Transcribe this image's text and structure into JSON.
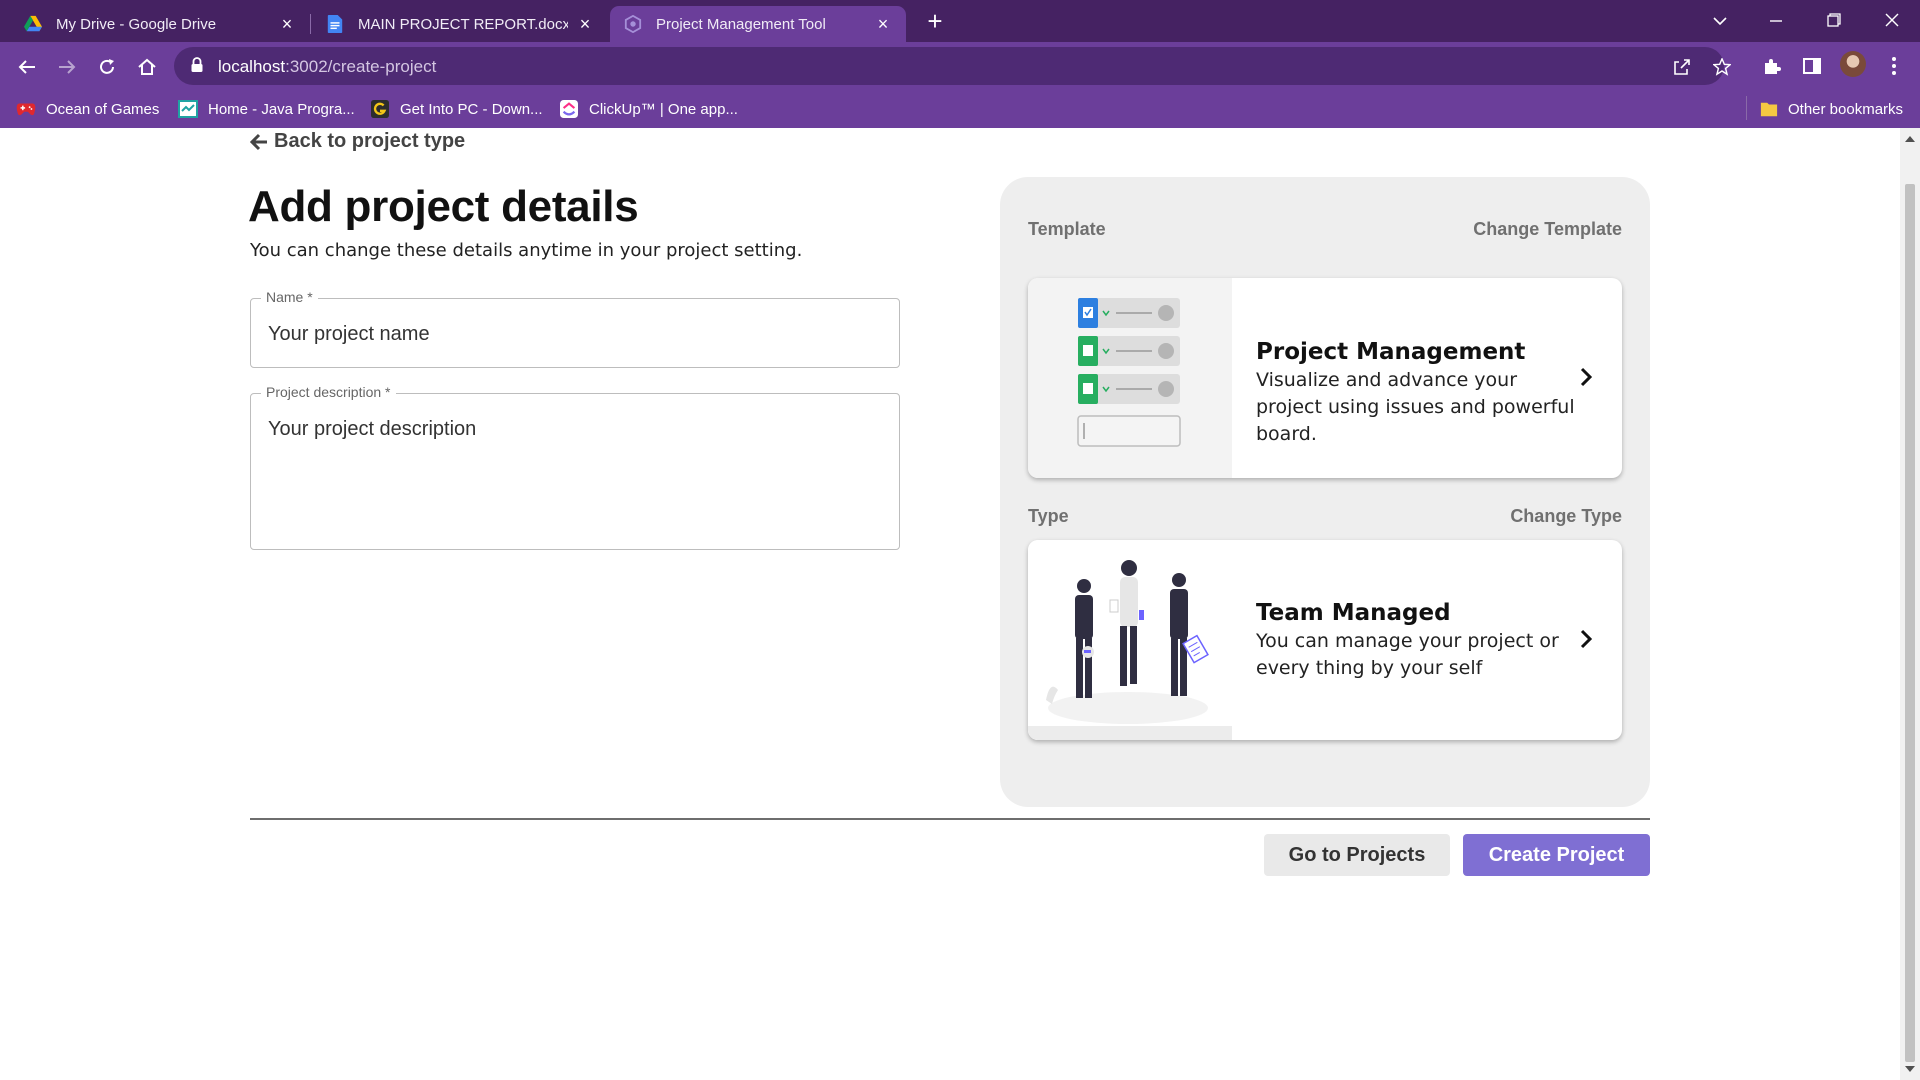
{
  "browser": {
    "tabs": [
      {
        "title": "My Drive - Google Drive",
        "icon": "google-drive-icon"
      },
      {
        "title": "MAIN PROJECT REPORT.docx - G",
        "icon": "google-docs-icon"
      },
      {
        "title": "Project Management Tool",
        "icon": "app-icon"
      }
    ],
    "url_host": "localhost",
    "url_path": ":3002/create-project",
    "bookmarks": [
      {
        "label": "Ocean of Games",
        "icon": "gamepad-icon"
      },
      {
        "label": "Home - Java Progra...",
        "icon": "java-site-icon"
      },
      {
        "label": "Get Into PC - Down...",
        "icon": "getintopc-icon"
      },
      {
        "label": "ClickUp™ | One app...",
        "icon": "clickup-icon"
      }
    ],
    "other_bookmarks": "Other bookmarks"
  },
  "page": {
    "back_link": "Back to project type",
    "title": "Add project details",
    "subtitle": "You can change these details anytime in your project setting.",
    "name_field": {
      "label": "Name *",
      "placeholder": "Your project name"
    },
    "description_field": {
      "label": "Project description *",
      "placeholder": "Your project description"
    },
    "template_section": {
      "label": "Template",
      "change_label": "Change Template",
      "card_title": "Project Management",
      "card_desc": "Visualize and advance your project using issues and powerful board."
    },
    "type_section": {
      "label": "Type",
      "change_label": "Change Type",
      "card_title": "Team Managed",
      "card_desc": "You can manage your project or every thing by your self"
    },
    "buttons": {
      "go_to_projects": "Go to Projects",
      "create_project": "Create Project"
    }
  },
  "colors": {
    "tabbar": "#452262",
    "toolbar": "#6b3e9a",
    "primary_button": "#7f6fd3",
    "panel_bg": "#eeeeee"
  }
}
